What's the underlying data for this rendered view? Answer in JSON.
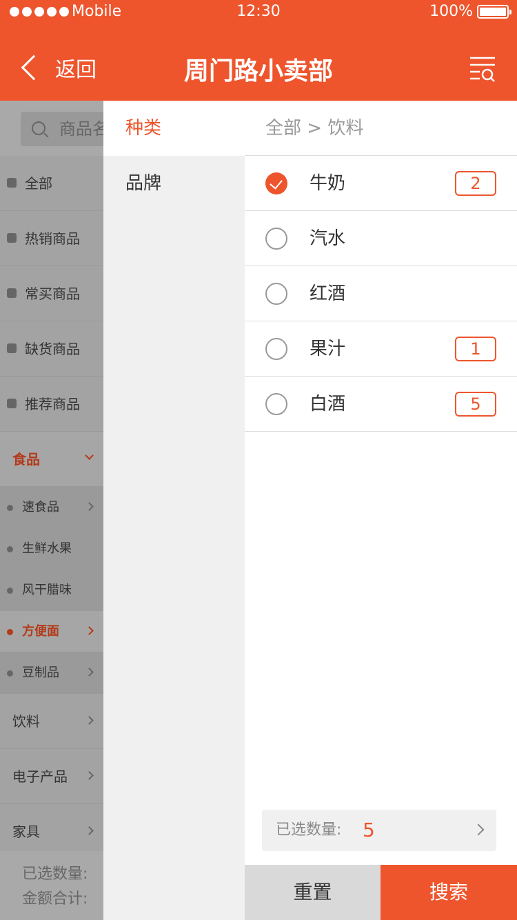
{
  "status_bar": {
    "carrier": "Mobile",
    "time": "12:30",
    "battery": "100%"
  },
  "nav": {
    "back_label": "返回",
    "title": "周门路小卖部"
  },
  "background": {
    "search_placeholder": "商品名",
    "items": [
      {
        "label": "全部"
      },
      {
        "label": "热销商品"
      },
      {
        "label": "常买商品"
      },
      {
        "label": "缺货商品"
      },
      {
        "label": "推荐商品"
      }
    ],
    "group_label": "食品",
    "sub_items": [
      {
        "label": "速食品"
      },
      {
        "label": "生鲜水果"
      },
      {
        "label": "风干腊味"
      },
      {
        "label": "方便面"
      },
      {
        "label": "豆制品"
      }
    ],
    "categories": [
      {
        "label": "饮料"
      },
      {
        "label": "电子产品"
      },
      {
        "label": "家具"
      }
    ],
    "footer_selected": "已选数量:",
    "footer_total": "金额合计:"
  },
  "drawer": {
    "tabs": [
      {
        "label": "种类"
      },
      {
        "label": "品牌"
      }
    ],
    "breadcrumb": "全部 > 饮料",
    "options": [
      {
        "label": "牛奶",
        "count": "2"
      },
      {
        "label": "汽水",
        "count": ""
      },
      {
        "label": "红酒",
        "count": ""
      },
      {
        "label": "果汁",
        "count": "1"
      },
      {
        "label": "白酒",
        "count": "5"
      }
    ],
    "selected_label": "已选数量:",
    "selected_count": "5",
    "reset_label": "重置",
    "search_label": "搜索"
  },
  "colors": {
    "accent": "#ee552d"
  }
}
